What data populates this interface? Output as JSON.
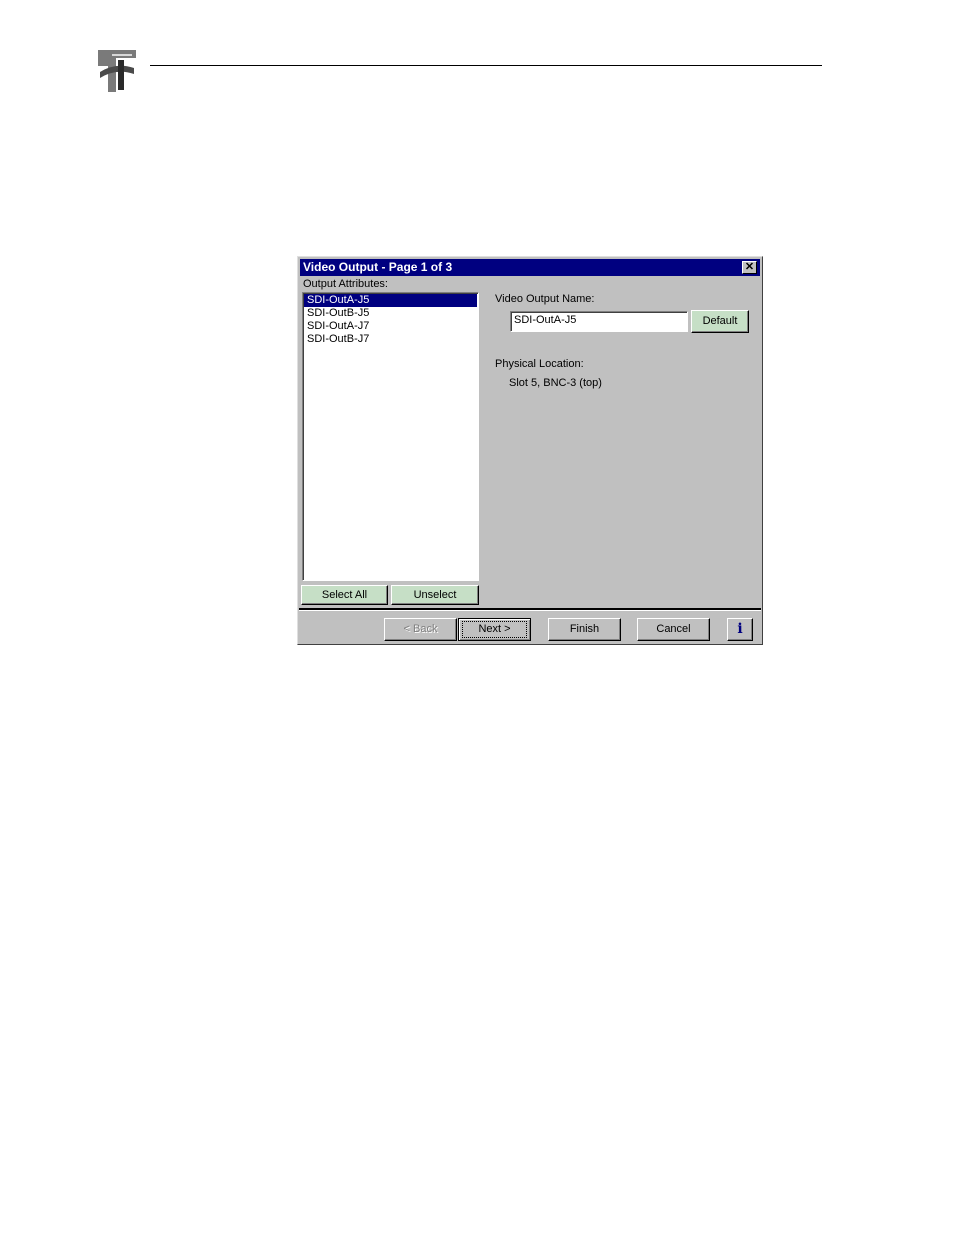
{
  "dialog": {
    "title": "Video Output - Page 1 of 3",
    "close_glyph": "✕",
    "output_attributes_label": "Output Attributes:",
    "outputs": [
      "SDI-OutA-J5",
      "SDI-OutB-J5",
      "SDI-OutA-J7",
      "SDI-OutB-J7"
    ],
    "selected_output": "SDI-OutA-J5",
    "select_all_label": "Select All",
    "unselect_label": "Unselect",
    "video_output_name_label": "Video Output Name:",
    "video_output_name_value": "SDI-OutA-J5",
    "default_label": "Default",
    "physical_location_label": "Physical Location:",
    "physical_location_value": "Slot 5, BNC-3 (top)",
    "back_label": "< Back",
    "next_label": "Next >",
    "finish_label": "Finish",
    "cancel_label": "Cancel",
    "info_label": "i"
  },
  "colors": {
    "titlebar": "#000080",
    "dialog_bg": "#c0c0c0",
    "green_button": "#c6dfc6"
  },
  "icons": {
    "logo": "company-logo",
    "close": "close-icon",
    "info": "info-icon"
  }
}
